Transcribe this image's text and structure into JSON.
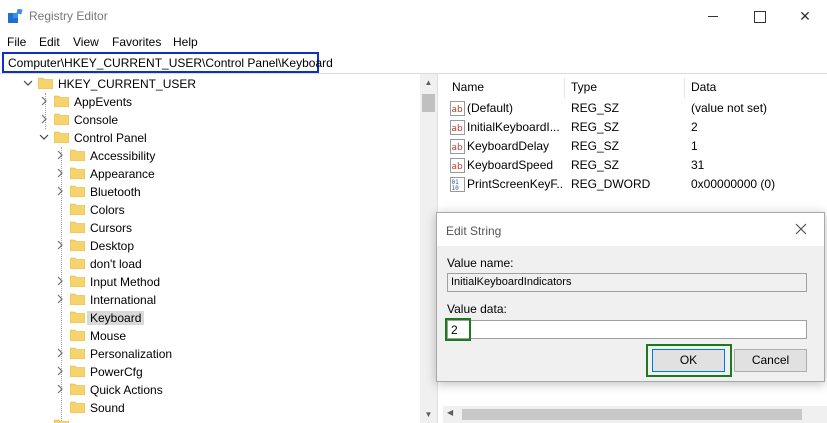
{
  "window": {
    "title": "Registry Editor",
    "controls": {
      "minimize": "minimize",
      "maximize": "maximize",
      "close": "✕"
    }
  },
  "menu": [
    "File",
    "Edit",
    "View",
    "Favorites",
    "Help"
  ],
  "address": {
    "path": "Computer\\HKEY_CURRENT_USER\\Control Panel\\Keyboard",
    "highlight_color": "#0a32c8"
  },
  "tree": {
    "root": "HKEY_CURRENT_USER",
    "level1": [
      {
        "label": "AppEvents",
        "expandable": true
      },
      {
        "label": "Console",
        "expandable": true
      },
      {
        "label": "Control Panel",
        "expanded": true
      }
    ],
    "control_panel_children": [
      {
        "label": "Accessibility",
        "expandable": true
      },
      {
        "label": "Appearance",
        "expandable": true
      },
      {
        "label": "Bluetooth",
        "expandable": true
      },
      {
        "label": "Colors",
        "expandable": false
      },
      {
        "label": "Cursors",
        "expandable": false
      },
      {
        "label": "Desktop",
        "expandable": true
      },
      {
        "label": "don't load",
        "expandable": false
      },
      {
        "label": "Input Method",
        "expandable": true
      },
      {
        "label": "International",
        "expandable": true
      },
      {
        "label": "Keyboard",
        "expandable": false,
        "selected": true
      },
      {
        "label": "Mouse",
        "expandable": false
      },
      {
        "label": "Personalization",
        "expandable": true
      },
      {
        "label": "PowerCfg",
        "expandable": true
      },
      {
        "label": "Quick Actions",
        "expandable": true
      },
      {
        "label": "Sound",
        "expandable": false
      }
    ]
  },
  "list": {
    "columns": [
      "Name",
      "Type",
      "Data"
    ],
    "rows": [
      {
        "icon": "string-value-icon",
        "name": "(Default)",
        "type": "REG_SZ",
        "data": "(value not set)"
      },
      {
        "icon": "string-value-icon",
        "name": "InitialKeyboardI...",
        "type": "REG_SZ",
        "data": "2"
      },
      {
        "icon": "string-value-icon",
        "name": "KeyboardDelay",
        "type": "REG_SZ",
        "data": "1"
      },
      {
        "icon": "string-value-icon",
        "name": "KeyboardSpeed",
        "type": "REG_SZ",
        "data": "31"
      },
      {
        "icon": "dword-value-icon",
        "name": "PrintScreenKeyF...",
        "type": "REG_DWORD",
        "data": "0x00000000 (0)"
      }
    ]
  },
  "dialog": {
    "title": "Edit String",
    "value_name_label": "Value name:",
    "value_name": "InitialKeyboardIndicators",
    "value_data_label": "Value data:",
    "value_data": "2",
    "ok_label": "OK",
    "cancel_label": "Cancel",
    "highlight_color": "#1c7a1c"
  },
  "colors": {
    "folder": "#f6d36b",
    "selected_bg": "#d9d9d9",
    "dialog_bg": "#f0f0f0"
  }
}
